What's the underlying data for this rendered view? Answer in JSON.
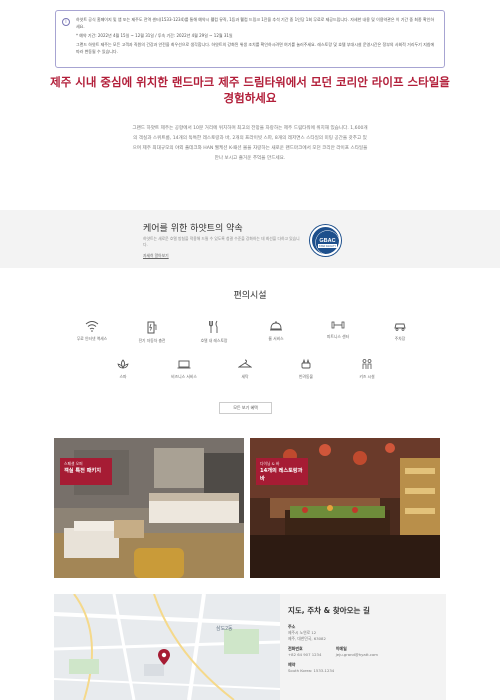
{
  "notice": {
    "line1": "하얏트 공식 홈페이지 및 앱 또는 제주도 전역 센터(1533-1234)를 통해 예약시 웰컴 뮤직, 1등과 웰컴 드링크 1잔을 추석 기간 중 1인당 1회 무료로 제공드립니다. 자세한 내용 및 이용약관은 이 기간 중 최종 확인하세요.",
    "line2": "* 예약 기간: 2022년 4월 15일 ~ 12월 31일 / 투숙 기간: 2022년 4월 29일 ~ 12월 31일",
    "line3": "그랜드 하얏트 제주는 모든 고객과 직원의 건강과 안전을 최우선으로 생각합니다. 하얏트의 강화된 위생 조치를 확인하시려면 여기를 눌러주세요. 레스토랑 및 호텔 부대시설 운영시간은 정부의 사회적 거리두기 지침에 따라 변동될 수 있습니다."
  },
  "headline": "제주 시내 중심에 위치한 랜드마크 제주 드림타워에서 모던 코리안 라이프 스타일을 경험하세요",
  "intro": "그랜드 하얏트 제주는 공항에서 10분 거리에 위치하며 최고의 전망을 자랑하는 제주 드림타워에 위치해 있습니다. 1,600개의 객실과 스위트룸, 14개의 독특한 레스토랑과 바, 2개의 프라이빗 스파, 8개의 레저면스 스타일의 미팅 공간을 갖추고 있으며 제주 최대규모의 야외 풀데크와 HAN 웰케션 K-패션 몰을 자랑하는 새로운 랜드마크에서 모던 코리안 라이프 스타일을 만나 보시고 즐거운 추억을 만드세요.",
  "care": {
    "title": "케어를 위한 하얏트의 약속",
    "desc": "하얏트는 새로운 호텔 방침을 적용해 드릴 수 있도록 청결 수준을 강화하는 데 최선을 다하고 있습니다.",
    "link": "자세히 알아보기",
    "badge_top": "GBAC",
    "badge_bottom": "STAR FACILITY"
  },
  "amenities": {
    "title": "편의시설",
    "items": [
      {
        "label": "무료 인터넷 액세스",
        "icon": "wifi-icon"
      },
      {
        "label": "전기 자동차 충전",
        "icon": "ev-charging-icon"
      },
      {
        "label": "호텔 내 레스토랑",
        "icon": "restaurant-icon"
      },
      {
        "label": "룸 서비스",
        "icon": "room-service-icon"
      },
      {
        "label": "피트니스 센터",
        "icon": "fitness-icon"
      },
      {
        "label": "주차장",
        "icon": "parking-icon"
      },
      {
        "label": "스파",
        "icon": "spa-icon"
      },
      {
        "label": "비즈니스 서비스",
        "icon": "business-icon"
      },
      {
        "label": "세탁",
        "icon": "laundry-icon"
      },
      {
        "label": "반려동물",
        "icon": "pet-icon"
      },
      {
        "label": "키즈 시설",
        "icon": "kids-icon"
      }
    ],
    "more_label": "모든 보기 혜택"
  },
  "promos": [
    {
      "small": "스페셜 오퍼",
      "big": "객실 특전 패키지"
    },
    {
      "small": "다이닝 & 바",
      "big": "14개의 레스토랑과 바"
    }
  ],
  "location": {
    "title": "지도, 주차 & 찾아오는 길",
    "address_label": "주소",
    "address": "제주시 노연로 12\n제주, 대한민국, 63082",
    "phone_label": "전화번호",
    "phone": "+82 64 907 1234",
    "email_label": "이메일",
    "email": "jeju.grand@hyatt.com",
    "reservation_label": "예약",
    "reservation": "South Korea: 1533-1234",
    "map_area_label": "삼도2동"
  },
  "colors": {
    "accent": "#b21f3a",
    "tag": "#a61c34",
    "badge": "#1d4f8c"
  }
}
